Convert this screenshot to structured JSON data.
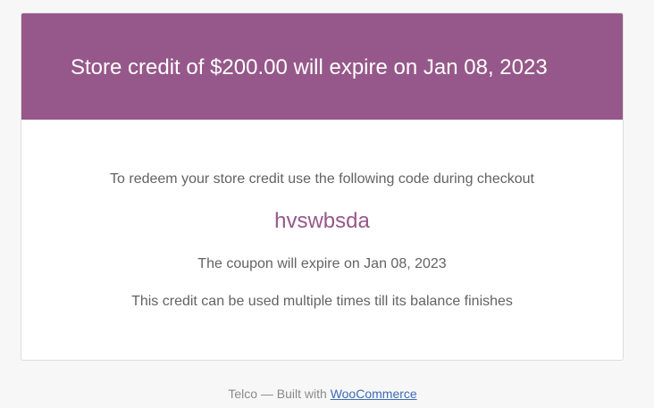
{
  "email": {
    "header_title": "Store credit of $200.00 will expire on Jan 08, 2023",
    "intro_text": "To redeem your store credit use the following code during checkout",
    "coupon_code": "hvswbsda",
    "expiry_text": "The coupon will expire on Jan 08, 2023",
    "usage_note": "This credit can be used multiple times till its balance finishes"
  },
  "footer": {
    "prefix": "Telco — Built with ",
    "link_label": "WooCommerce"
  },
  "colors": {
    "brand": "#96588a",
    "page_background": "#f7f7f7",
    "text": "#636363",
    "link": "#3c6bb5"
  }
}
